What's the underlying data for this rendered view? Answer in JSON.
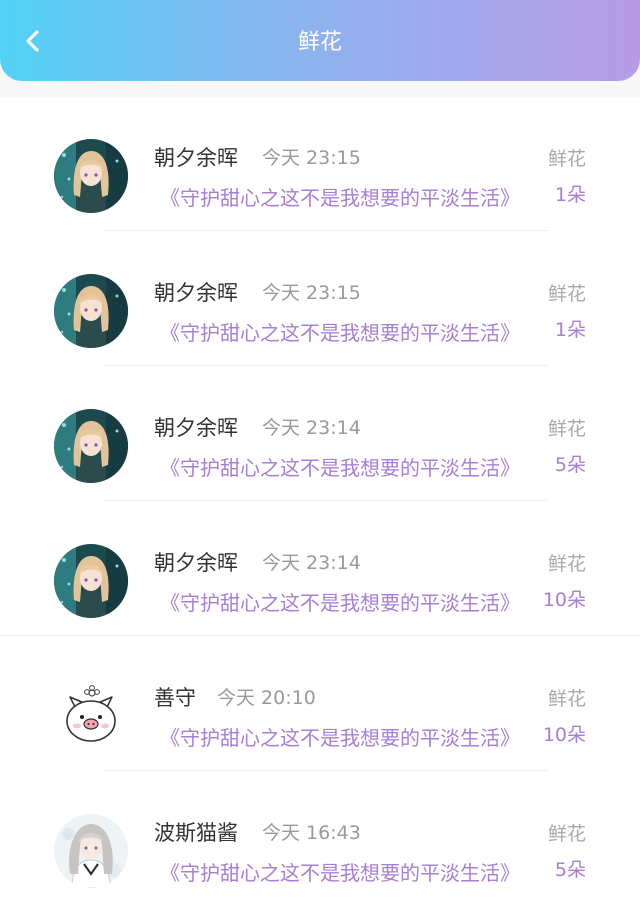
{
  "header": {
    "title": "鲜花",
    "back_icon": "chevron-left-icon",
    "gradient_colors": [
      "#52d2f5",
      "#b99ae8"
    ]
  },
  "records": [
    {
      "name": "朝夕余晖",
      "time": "今天 23:15",
      "book": "《守护甜心之这不是我想要的平淡生活》",
      "type": "鲜花",
      "count": "1朵",
      "avatar": "anime-girl-avatar"
    },
    {
      "name": "朝夕余晖",
      "time": "今天 23:15",
      "book": "《守护甜心之这不是我想要的平淡生活》",
      "type": "鲜花",
      "count": "1朵",
      "avatar": "anime-girl-avatar"
    },
    {
      "name": "朝夕余晖",
      "time": "今天 23:14",
      "book": "《守护甜心之这不是我想要的平淡生活》",
      "type": "鲜花",
      "count": "5朵",
      "avatar": "anime-girl-avatar"
    },
    {
      "name": "朝夕余晖",
      "time": "今天 23:14",
      "book": "《守护甜心之这不是我想要的平淡生活》",
      "type": "鲜花",
      "count": "10朵",
      "avatar": "anime-girl-avatar"
    },
    {
      "name": "善守",
      "time": "今天 20:10",
      "book": "《守护甜心之这不是我想要的平淡生活》",
      "type": "鲜花",
      "count": "10朵",
      "avatar": "pig-avatar"
    },
    {
      "name": "波斯猫酱",
      "time": "今天 16:43",
      "book": "《守护甜心之这不是我想要的平淡生活》",
      "type": "鲜花",
      "count": "5朵",
      "avatar": "silver-hair-girl-avatar"
    }
  ],
  "colors": {
    "accent": "#a77fd3",
    "muted": "#999999",
    "text": "#333333"
  }
}
